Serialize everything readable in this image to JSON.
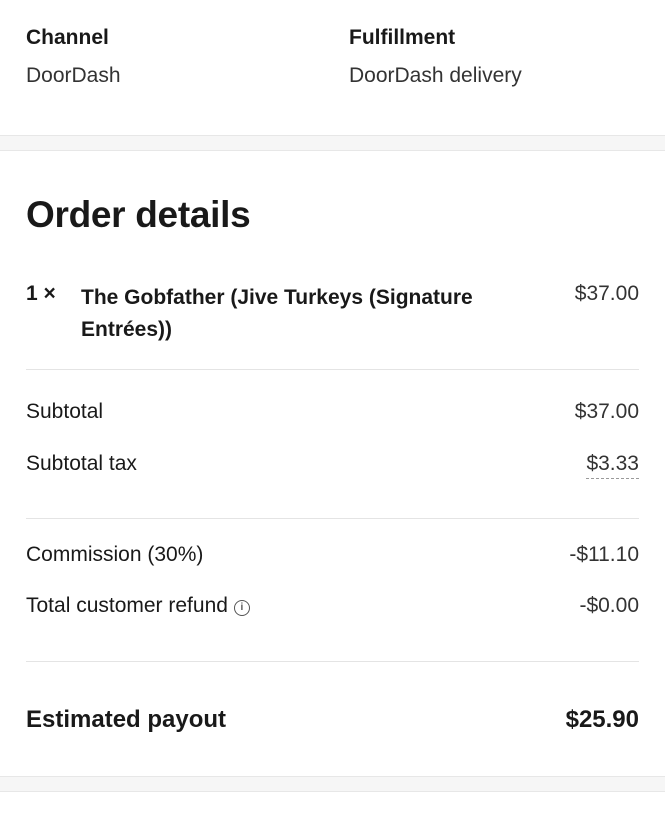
{
  "order_info": {
    "channel_label": "Channel",
    "channel_value": "DoorDash",
    "fulfillment_label": "Fulfillment",
    "fulfillment_value": "DoorDash delivery"
  },
  "order_details": {
    "title": "Order details",
    "items": [
      {
        "qty": "1 ×",
        "name": "The Gobfather (Jive Turkeys (Signature Entrées))",
        "price": "$37.00"
      }
    ],
    "subtotal_label": "Subtotal",
    "subtotal_value": "$37.00",
    "subtotal_tax_label": "Subtotal tax",
    "subtotal_tax_value": "$3.33",
    "commission_label": "Commission (30%)",
    "commission_value": "-$11.10",
    "refund_label": "Total customer refund",
    "refund_value": "-$0.00",
    "refund_icon": "info-icon",
    "payout_label": "Estimated payout",
    "payout_value": "$25.90"
  }
}
